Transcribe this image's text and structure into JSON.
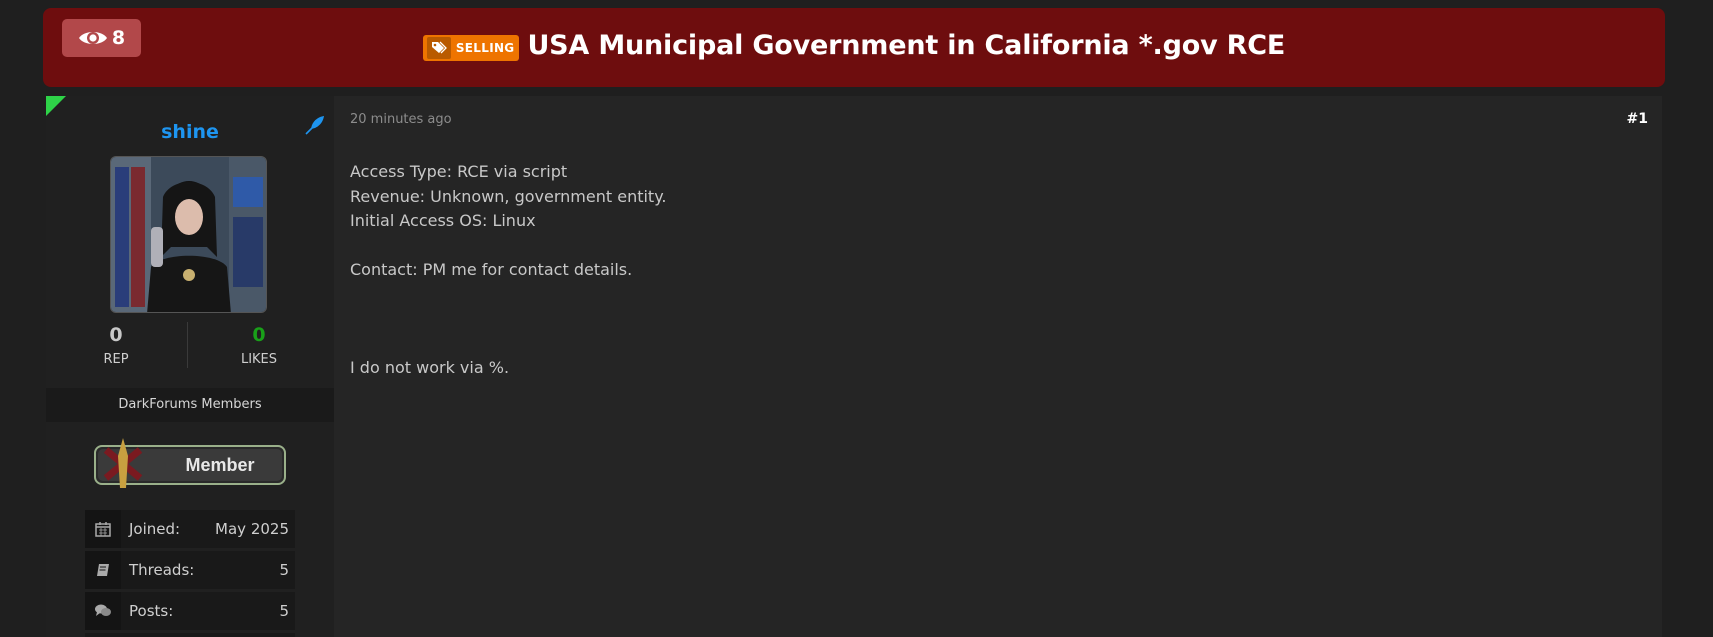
{
  "header": {
    "views": "8",
    "tag": "SELLING",
    "title": "USA Municipal Government in California *.gov RCE"
  },
  "author": {
    "username": "shine",
    "rep_value": "0",
    "rep_label": "REP",
    "likes_value": "0",
    "likes_label": "LIKES",
    "group": "DarkForums Members",
    "badge_label": "Member",
    "info": [
      {
        "label": "Joined:",
        "value": "May 2025",
        "icon": "calendar-icon"
      },
      {
        "label": "Threads:",
        "value": "5",
        "icon": "book-icon"
      },
      {
        "label": "Posts:",
        "value": "5",
        "icon": "comments-icon"
      }
    ]
  },
  "post": {
    "time": "20 minutes ago",
    "number": "#1",
    "lines": [
      "Access Type: RCE via script",
      "Revenue: Unknown, government entity.",
      "Initial Access OS: Linux",
      "",
      "Contact: PM me for contact details.",
      "",
      "",
      "",
      "I do not work via %."
    ]
  },
  "colors": {
    "header_bg": "#6e0d0e",
    "selling_tag": "#ee7400",
    "username": "#1e95f0",
    "likes": "#19a019"
  }
}
